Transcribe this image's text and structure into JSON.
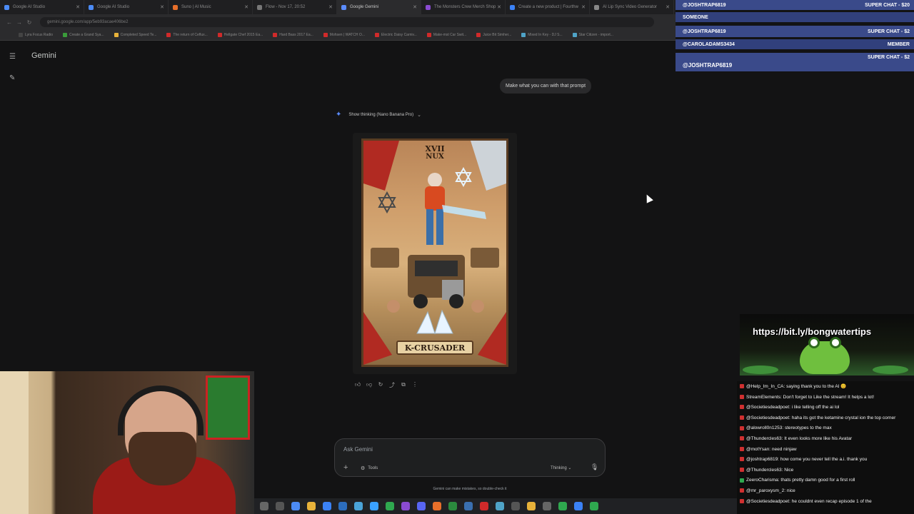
{
  "browser": {
    "tabs": [
      {
        "title": "Google AI Studio",
        "color": "#4c8bf5"
      },
      {
        "title": "Google AI Studio",
        "color": "#4c8bf5"
      },
      {
        "title": "Suno | AI Music",
        "color": "#e86f2a"
      },
      {
        "title": "Flow - Nov 17, 20:52",
        "color": "#777777"
      },
      {
        "title": "Google Gemini",
        "color": "#5b8cff"
      },
      {
        "title": "The Monsters Crew Merch Shop",
        "color": "#8a4bd1"
      },
      {
        "title": "Create a new product | Fourthw",
        "color": "#3b82f6"
      },
      {
        "title": "AI Lip Sync Video Generator",
        "color": "#888888"
      }
    ],
    "url": "gemini.google.com/app/5eb93acae406be2",
    "bookmarks": [
      "Lyra Focus Radio",
      "Create a Grand Sya...",
      "Completed Speed Te...",
      "The return of Ceflux...",
      "Hellgate Chef 2015 Ea...",
      "Hard Bass 2017 Ea...",
      "Mohsen | WATCH O...",
      "Electric Daisy Carniv...",
      "Make-mst Car Swit...",
      "Juice Bit Simher...",
      "Mixed In Key - DJ S...",
      "Star Citizen - import..."
    ]
  },
  "app": {
    "title": "Gemini",
    "user_message": "Make what you can with that prompt",
    "thinking_label": "Show thinking (Nano Banana Pro)",
    "card": {
      "number": "XVII",
      "name": "NUX",
      "banner": "K-CRUSADER"
    },
    "prompt_placeholder": "Ask Gemini",
    "tools_label": "Tools",
    "mode_label": "Thinking",
    "disclaimer": "Gemini can make mistakes, so double-check it"
  },
  "overlay": {
    "superchats": [
      {
        "name": "@JOSHTRAP6819",
        "amount": "SUPER CHAT - $20"
      },
      {
        "name": "SOMEONE",
        "amount": ""
      },
      {
        "name": "@JOSHTRAP6819",
        "amount": "SUPER CHAT - $2"
      },
      {
        "name": "@CAROLADAMS3434",
        "amount": "MEMBER"
      },
      {
        "name": "@JOSHTRAP6819",
        "amount": "SUPER CHAT - $2"
      }
    ],
    "banner_url": "https://bit.ly/bongwatertips",
    "chat": [
      {
        "user": "@Help_Im_In_CA:",
        "text": "saying thank you to the AI 😊",
        "badge": "red"
      },
      {
        "user": "StreamElements:",
        "text": "Don't forget to Like the stream! It helps a lot!",
        "badge": "red"
      },
      {
        "user": "@Societiesdeadpoet:",
        "text": "i like telling off the ai lol",
        "badge": "red"
      },
      {
        "user": "@Societiesdeadpoet:",
        "text": "haha its got the ketamine crystal ion the top corner",
        "badge": "red"
      },
      {
        "user": "@alowroll0n1253:",
        "text": "stereotypes to the max",
        "badge": "red"
      },
      {
        "user": "@Thundercles63:",
        "text": "It even looks more like his Avatar",
        "badge": "red"
      },
      {
        "user": "@motYsan:",
        "text": "need ninjaw",
        "badge": "red"
      },
      {
        "user": "@joshtrap6819:",
        "text": "how come you never tell the a.i. thank you",
        "badge": "red"
      },
      {
        "user": "@Thundercles63:",
        "text": "Nice",
        "badge": "red"
      },
      {
        "user": "ZeeroCharisma:",
        "text": "thats pretty damn good for a first roll",
        "badge": "green"
      },
      {
        "user": "@mr_paroxysm_2:",
        "text": "nice",
        "badge": "red"
      },
      {
        "user": "@Societiesdeadpoet:",
        "text": "he couldnt even recap episode 1 of the",
        "badge": "red"
      }
    ]
  },
  "colors": {
    "background": "#131314",
    "accent": "#5b8cff",
    "superchat": "#3a4a8a"
  }
}
